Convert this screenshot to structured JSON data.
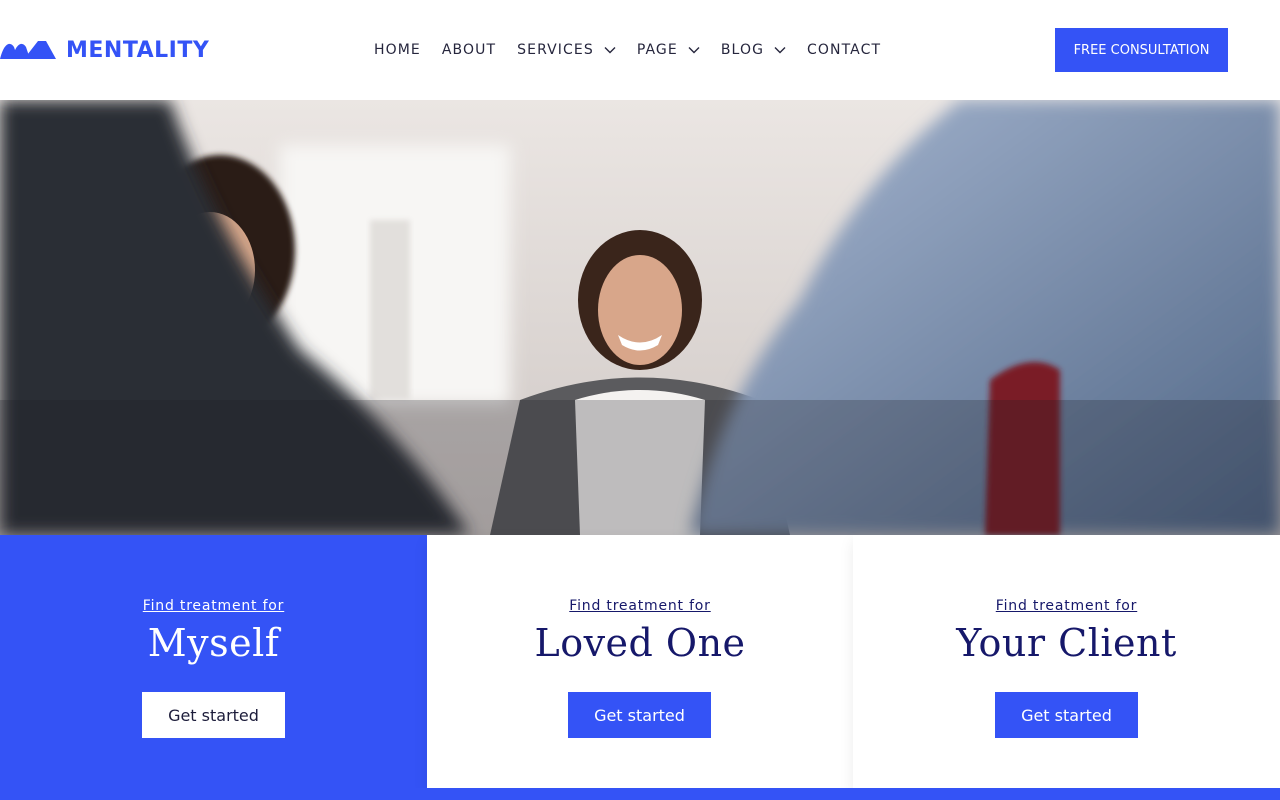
{
  "brand": {
    "name": "MENTALITY",
    "accent_color": "#3453f6",
    "dark_text_color": "#16186a",
    "logo_icon": "mountain-waves-logo-icon"
  },
  "nav": {
    "items": [
      {
        "label": "HOME",
        "has_dropdown": false
      },
      {
        "label": "ABOUT",
        "has_dropdown": false
      },
      {
        "label": "SERVICES",
        "has_dropdown": true
      },
      {
        "label": "PAGE",
        "has_dropdown": true
      },
      {
        "label": "BLOG",
        "has_dropdown": true
      },
      {
        "label": "CONTACT",
        "has_dropdown": false
      }
    ],
    "dropdown_icon": "chevron-down-icon"
  },
  "header": {
    "cta_label": "FREE CONSULTATION"
  },
  "hero": {
    "image_description_icon": "hero-photo"
  },
  "cards": [
    {
      "eyebrow": "Find treatment for",
      "title": "Myself",
      "button": "Get started"
    },
    {
      "eyebrow": "Find treatment for",
      "title": "Loved One",
      "button": "Get started"
    },
    {
      "eyebrow": "Find treatment for",
      "title": "Your Client",
      "button": "Get started"
    }
  ]
}
